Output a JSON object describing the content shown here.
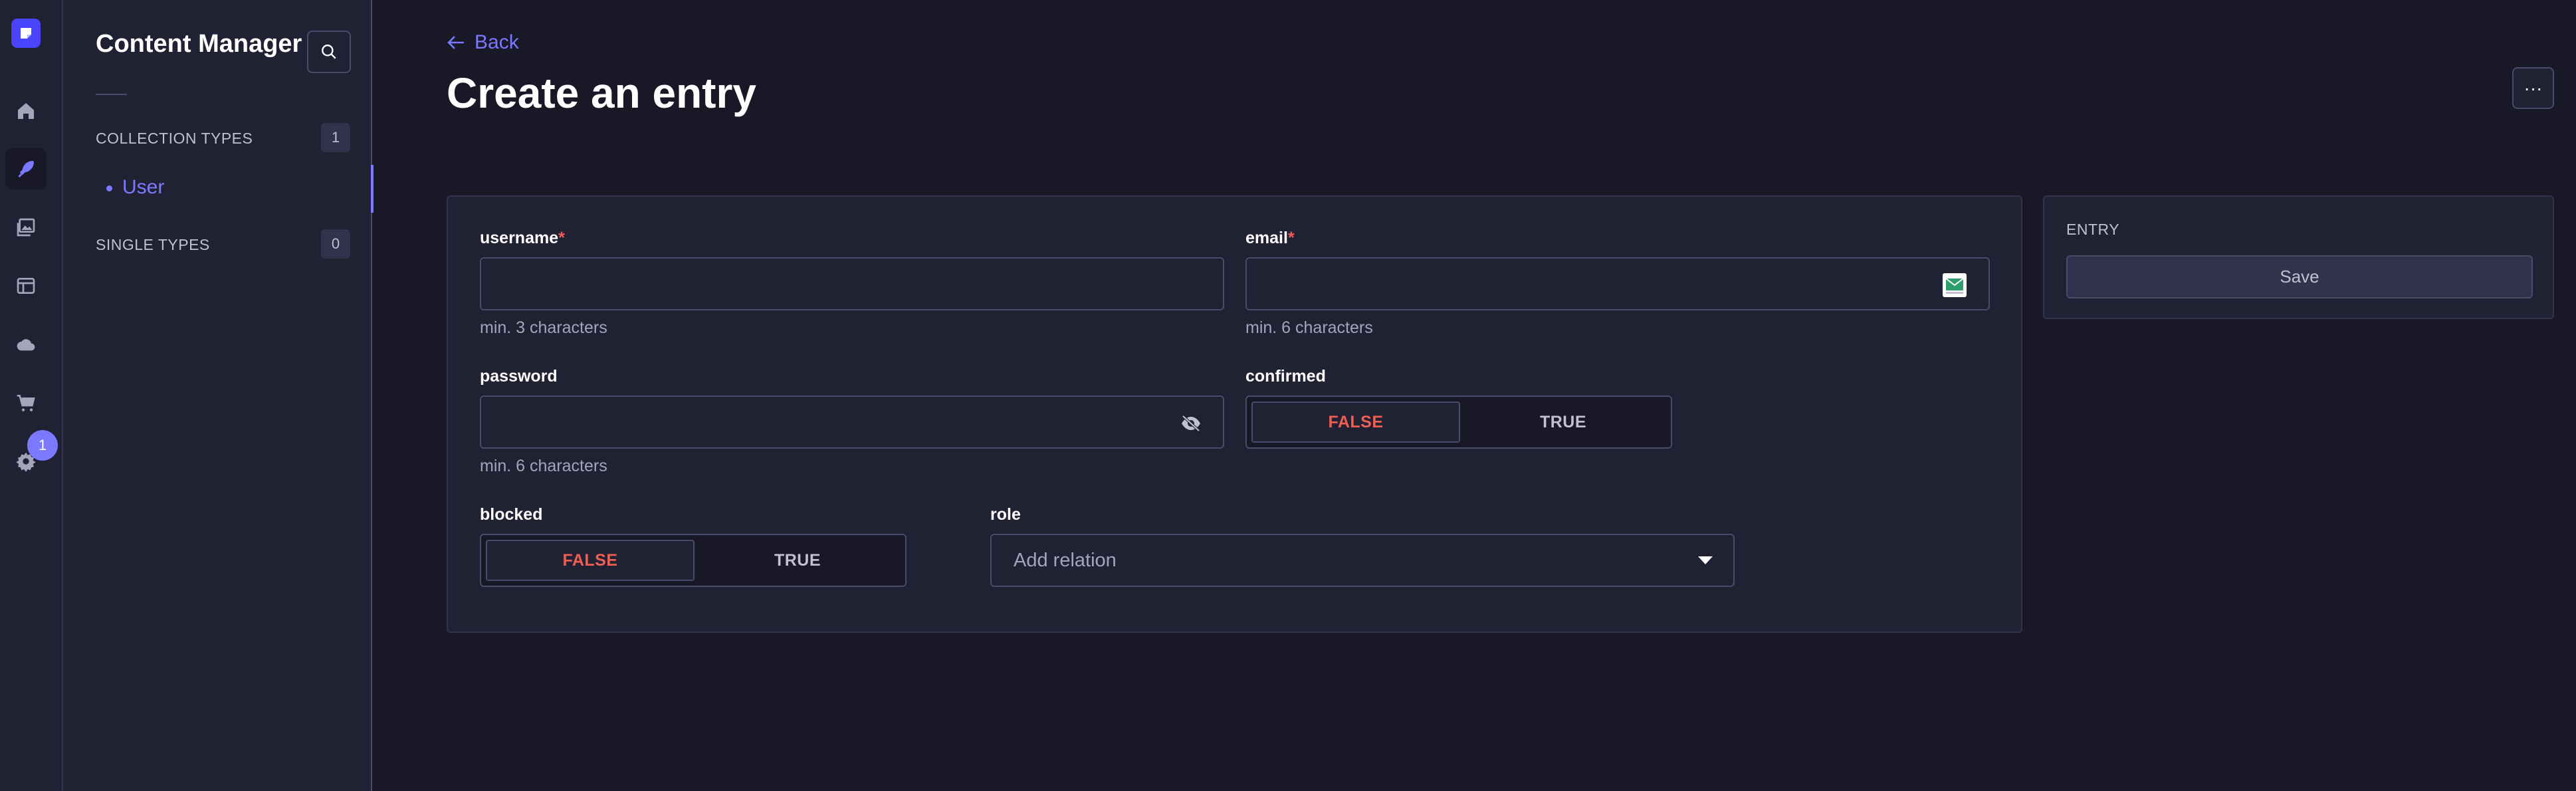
{
  "colors": {
    "accent": "#7b79ff",
    "brand": "#4945ff",
    "danger": "#ee5e52",
    "background": "#181826",
    "surface": "#212134"
  },
  "rail": {
    "icons": [
      "logo-icon",
      "home-icon",
      "content-manager-icon",
      "media-library-icon",
      "content-type-builder-icon",
      "cloud-icon",
      "marketplace-icon",
      "settings-icon"
    ],
    "settings_badge": "1"
  },
  "subnav": {
    "title": "Content Manager",
    "collection_types_label": "COLLECTION TYPES",
    "collection_types_count": "1",
    "collection_items": [
      {
        "label": "User"
      }
    ],
    "single_types_label": "SINGLE TYPES",
    "single_types_count": "0"
  },
  "header": {
    "back_label": "Back",
    "title": "Create an entry",
    "more_label": "···"
  },
  "form": {
    "username": {
      "label": "username",
      "required": "*",
      "value": "",
      "hint": "min. 3 characters"
    },
    "email": {
      "label": "email",
      "required": "*",
      "value": "",
      "hint": "min. 6 characters"
    },
    "password": {
      "label": "password",
      "value": "",
      "hint": "min. 6 characters"
    },
    "confirmed": {
      "label": "confirmed",
      "false_label": "FALSE",
      "true_label": "TRUE",
      "selected": "FALSE"
    },
    "blocked": {
      "label": "blocked",
      "false_label": "FALSE",
      "true_label": "TRUE",
      "selected": "FALSE"
    },
    "role": {
      "label": "role",
      "placeholder": "Add relation"
    }
  },
  "side_panel": {
    "heading": "ENTRY",
    "save_label": "Save"
  }
}
